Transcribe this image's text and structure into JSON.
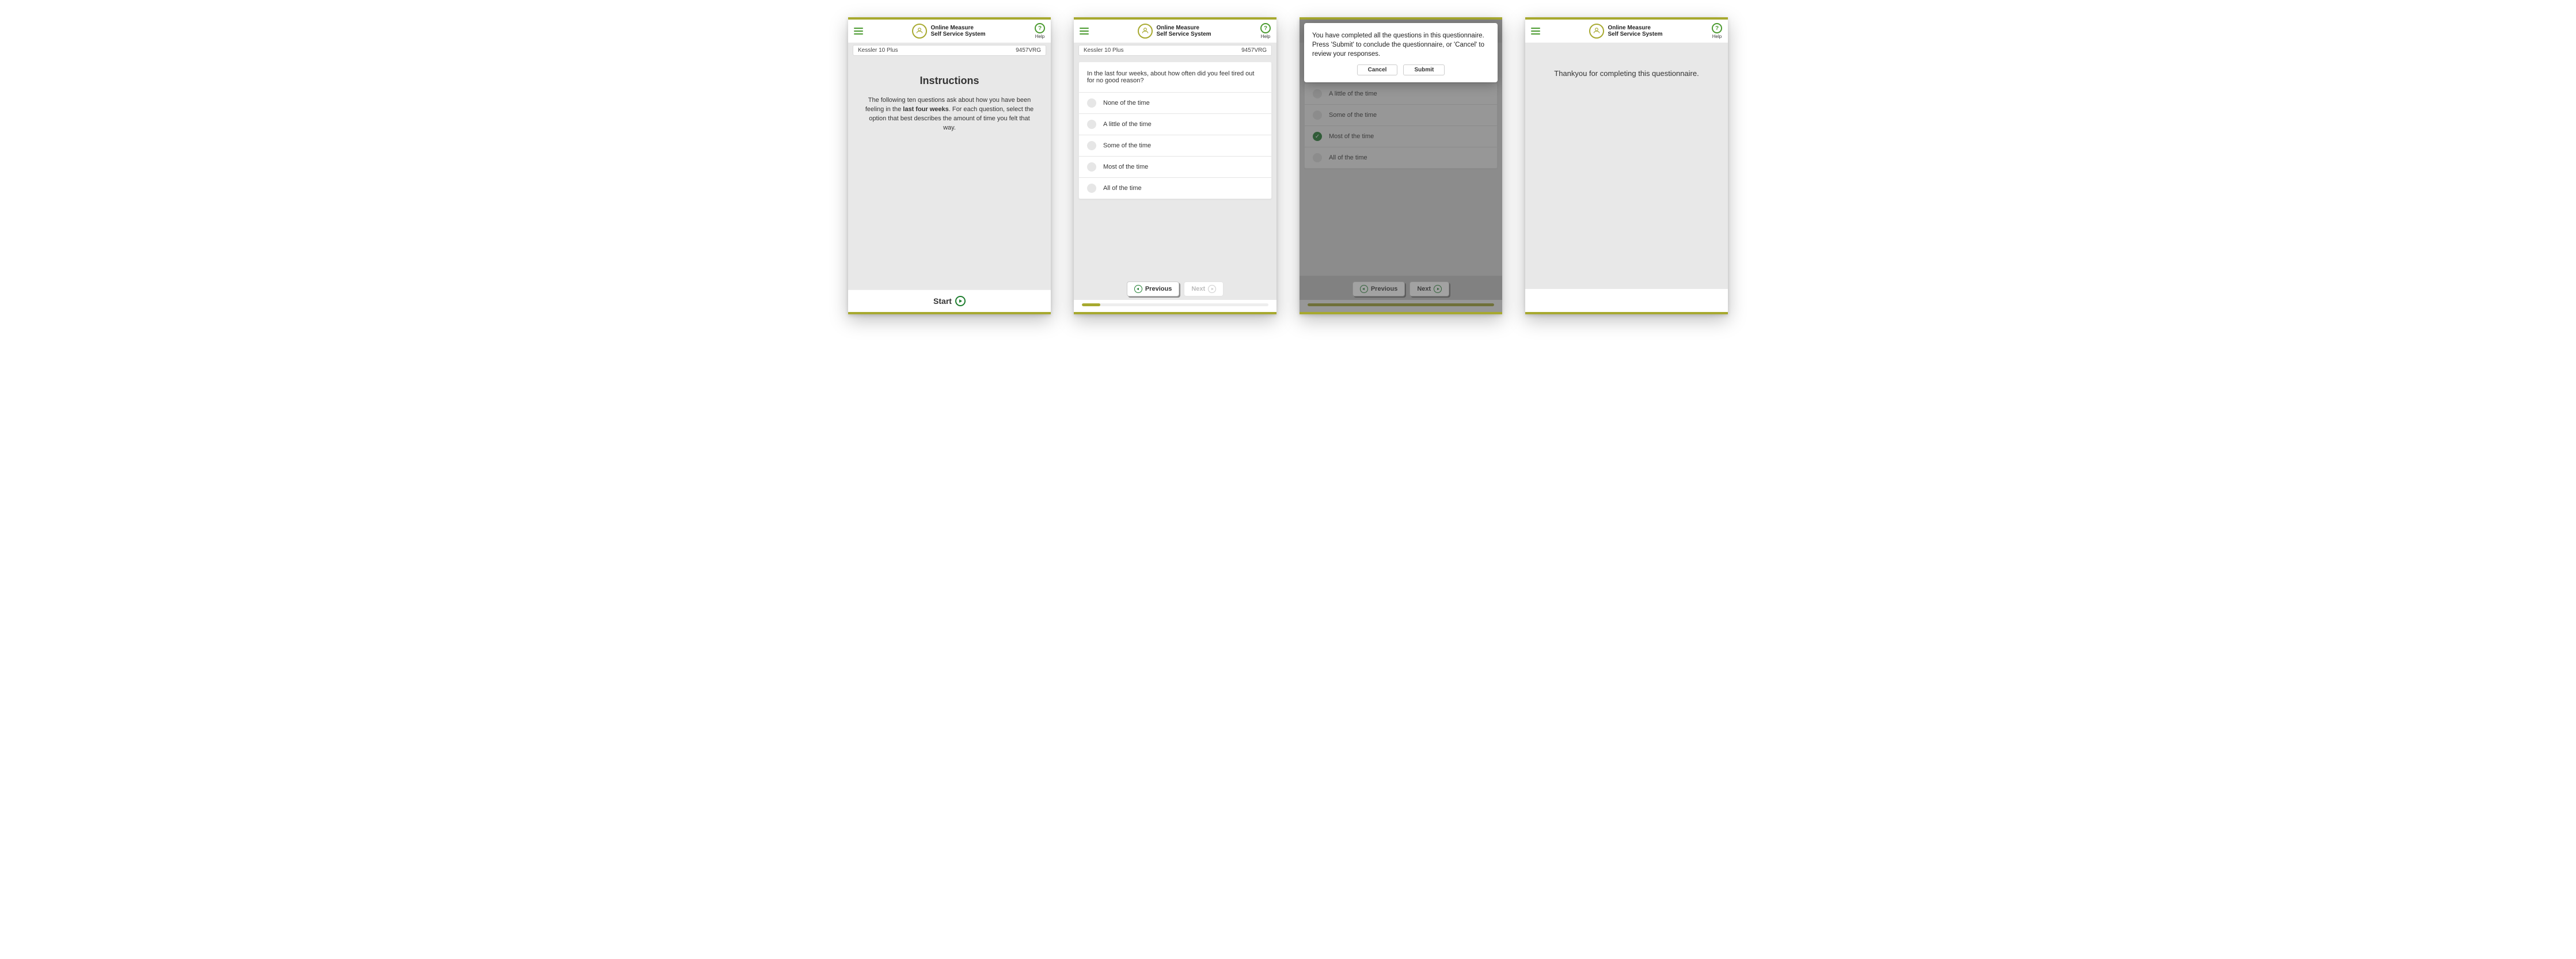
{
  "brand": {
    "line1": "Online Measure",
    "line2": "Self Service System"
  },
  "help_label": "Help",
  "titlebar": {
    "name": "Kessler 10 Plus",
    "code": "9457VRG"
  },
  "screen1": {
    "heading": "Instructions",
    "intro_a": "The following ten questions ask about how you have been feeling in the ",
    "intro_bold": "last four weeks",
    "intro_b": ". For each question, select the option that best describes the amount of time you felt that way.",
    "start_label": "Start"
  },
  "question": {
    "text": "In the last four weeks, about how often did you feel tired out for no good reason?",
    "options": [
      "None of the time",
      "A little of the time",
      "Some of the time",
      "Most of the time",
      "All of the time"
    ]
  },
  "nav": {
    "previous": "Previous",
    "next": "Next"
  },
  "progress": {
    "screen2_pct": 10,
    "screen3_pct": 100
  },
  "modal": {
    "text": "You have completed all the questions in this questionnaire. Press 'Submit' to conclude the questionnaire, or 'Cancel' to review your responses.",
    "cancel": "Cancel",
    "submit": "Submit"
  },
  "screen4": {
    "thankyou": "Thankyou for completing this questionnaire."
  },
  "selected_index_screen3": 3
}
